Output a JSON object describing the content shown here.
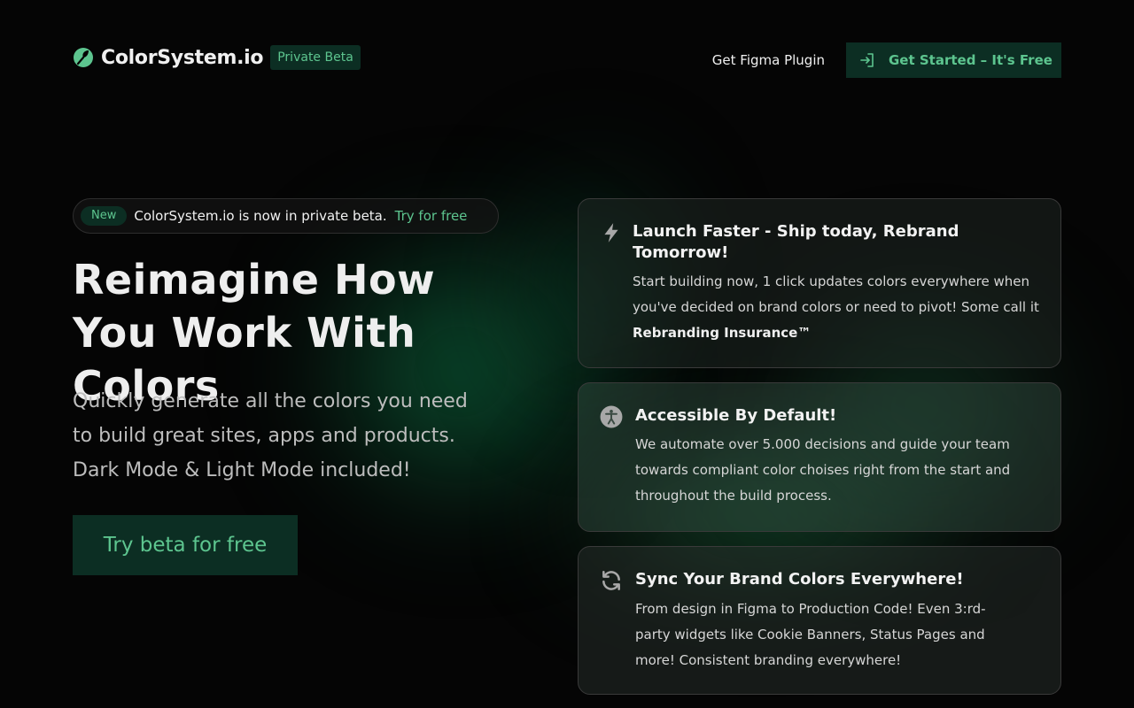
{
  "header": {
    "brand_name": "ColorSystem.io",
    "beta_badge": "Private Beta",
    "nav_link": "Get Figma Plugin",
    "cta_label": "Get Started – It's Free"
  },
  "announcement": {
    "pill": "New",
    "text": "ColorSystem.io is now in private beta.",
    "link": "Try for free"
  },
  "hero": {
    "title": "Reimagine How You Work With Colors",
    "subtitle": "Quickly generate all the colors you need to build great sites, apps and products. Dark Mode & Light Mode included!",
    "cta_label": "Try beta for free"
  },
  "features": [
    {
      "icon": "lightning-icon",
      "title": "Launch Faster - Ship today, Rebrand Tomorrow!",
      "body": "Start building now, 1 click updates colors everywhere when you've decided on brand colors or need to pivot! Some call it",
      "body_strong": "Rebranding Insurance™"
    },
    {
      "icon": "accessibility-icon",
      "title": "Accessible By Default!",
      "body": "We automate over 5.000 decisions and guide your team towards compliant color choises right from the start and throughout the build process."
    },
    {
      "icon": "sync-icon",
      "title": "Sync Your Brand Colors Everywhere!",
      "body": "From design in Figma to Production Code! Even 3:rd-party widgets like Cookie Banners, Status Pages and more! Consistent branding everywhere!"
    }
  ],
  "colors": {
    "accent": "#5dc58f",
    "accent_bg": "#0c2e23",
    "background": "#050505"
  }
}
